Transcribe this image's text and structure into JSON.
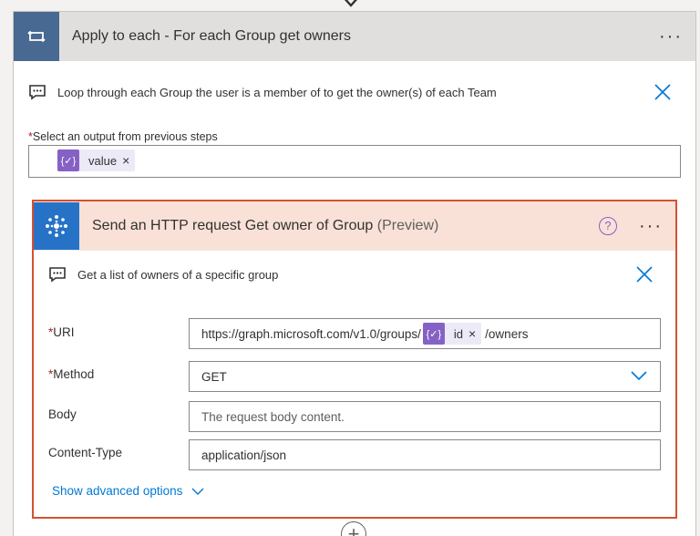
{
  "loop": {
    "title": "Apply to each - For each Group get owners",
    "comment": "Loop through each Group the user is a member of to get the owner(s) of each Team",
    "select_required": "*",
    "select_label": "Select an output from previous steps",
    "token_label": "value",
    "token_remove": "×"
  },
  "action": {
    "title": "Send an HTTP request Get owner of Group",
    "preview": "(Preview)",
    "help": "?",
    "comment": "Get a list of owners of a specific group",
    "uri": {
      "required": "*",
      "label": "URI",
      "prefix": "https://graph.microsoft.com/v1.0/groups/",
      "token": "id",
      "token_remove": "×",
      "suffix": "/owners"
    },
    "method": {
      "required": "*",
      "label": "Method",
      "value": "GET"
    },
    "body": {
      "label": "Body",
      "placeholder": "The request body content."
    },
    "content_type": {
      "label": "Content-Type",
      "value": "application/json"
    },
    "advanced": "Show advanced options"
  },
  "menu_more": "···",
  "token_icon_glyph": "{✓}",
  "colors": {
    "loop_badge": "#486991",
    "http_badge": "#2672c7",
    "selected_border": "#d35230",
    "token": "#8661c5",
    "link": "#0078d4"
  },
  "icons": [
    "loop-icon",
    "comment-icon",
    "close-icon",
    "http-icon",
    "help-icon",
    "chevron-down-icon",
    "more-icon",
    "add-icon"
  ]
}
